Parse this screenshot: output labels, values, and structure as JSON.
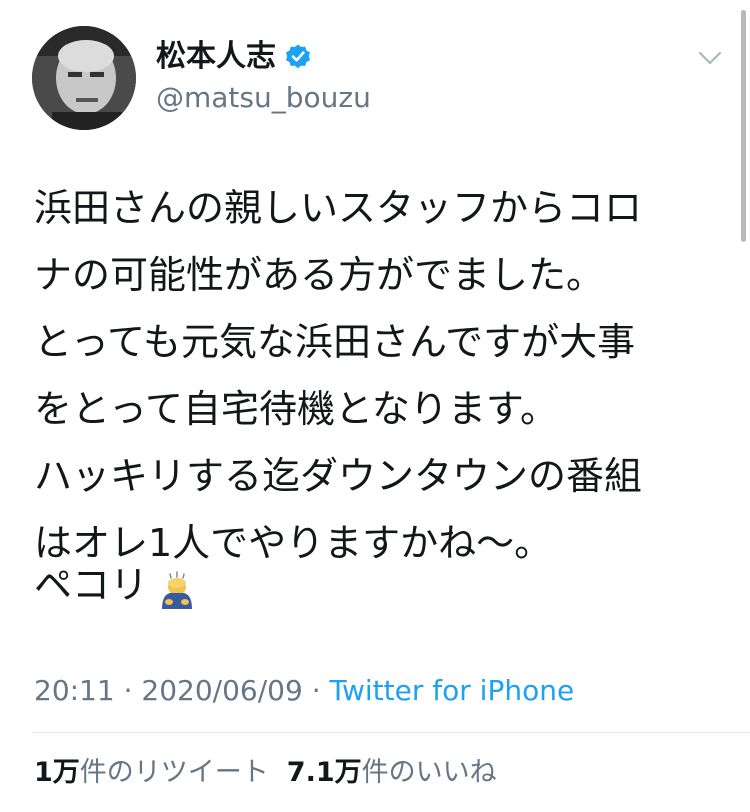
{
  "user": {
    "display_name": "松本人志",
    "handle": "@matsu_bouzu",
    "verified": true
  },
  "tweet": {
    "lines": [
      "浜田さんの親しいスタッフからコロ",
      "ナの可能性がある方がでました。",
      "とっても元気な浜田さんですが大事",
      "をとって自宅待機となります。",
      "ハッキリする迄ダウンタウンの番組",
      "はオレ1人でやりますかね〜。"
    ],
    "closing": "ペコリ",
    "closing_emoji": "person-bowing-emoji"
  },
  "meta": {
    "time": "20:11",
    "date": "2020/06/09",
    "separator": "·",
    "source": "Twitter for iPhone"
  },
  "stats": {
    "retweets_num": "1",
    "retweets_unit": "万",
    "retweets_label": "件のリツイート",
    "likes_num": "7.1",
    "likes_unit": "万",
    "likes_label": "件のいいね"
  },
  "colors": {
    "text": "#14171a",
    "secondary": "#657786",
    "link": "#1da1f2",
    "verified": "#1da1f2",
    "divider": "#e1e8ed"
  },
  "icons": {
    "verified": "verified-badge-icon",
    "menu": "chevron-down-icon"
  }
}
